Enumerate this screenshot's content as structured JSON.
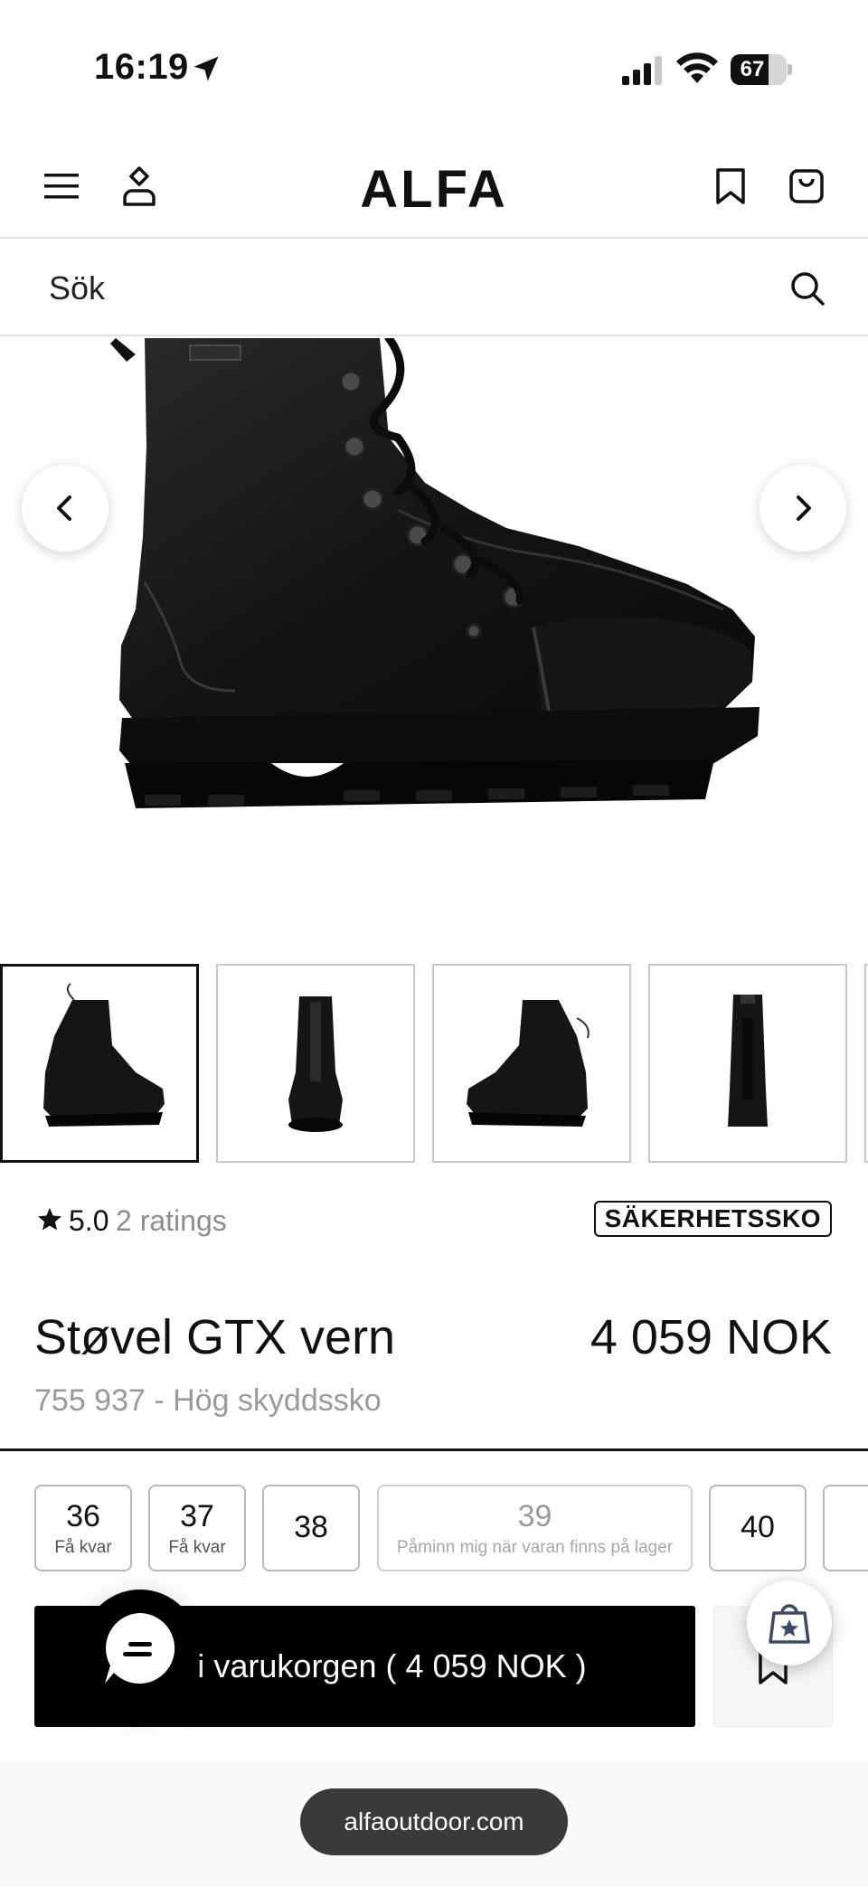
{
  "status_bar": {
    "time": "16:19",
    "battery": "67",
    "battery_level": 0.67,
    "icons": [
      "location-arrow-icon",
      "cellular-signal-icon",
      "wifi-icon",
      "battery-icon"
    ]
  },
  "header": {
    "logo": "ALFA",
    "icons": [
      "menu-icon",
      "account-icon",
      "bookmark-icon",
      "cart-icon"
    ]
  },
  "search": {
    "placeholder": "Sök",
    "icon": "search-icon"
  },
  "gallery": {
    "prev_icon": "chevron-left-icon",
    "next_icon": "chevron-right-icon",
    "thumbnail_count": 4,
    "active_thumbnail": 0
  },
  "rating": {
    "value": "5.0",
    "count_label": "2 ratings",
    "badge": "SÄKERHETSSKO"
  },
  "product": {
    "title": "Støvel GTX vern",
    "price": "4 059 NOK",
    "subtitle": "755 937 - Hög skyddssko"
  },
  "sizes": [
    {
      "size": "36",
      "note": "Få kvar",
      "available": true
    },
    {
      "size": "37",
      "note": "Få kvar",
      "available": true
    },
    {
      "size": "38",
      "note": "",
      "available": true
    },
    {
      "size": "39",
      "note": "Påminn mig när varan finns på lager",
      "available": false
    },
    {
      "size": "40",
      "note": "",
      "available": true
    }
  ],
  "cart": {
    "label": ", i varukorgen ( 4 059 NOK )"
  },
  "browser": {
    "url": "alfaoutdoor.com"
  },
  "colors": {
    "primary": "#000000",
    "muted_text": "#9a9a9a",
    "border": "#e3e3e3"
  }
}
